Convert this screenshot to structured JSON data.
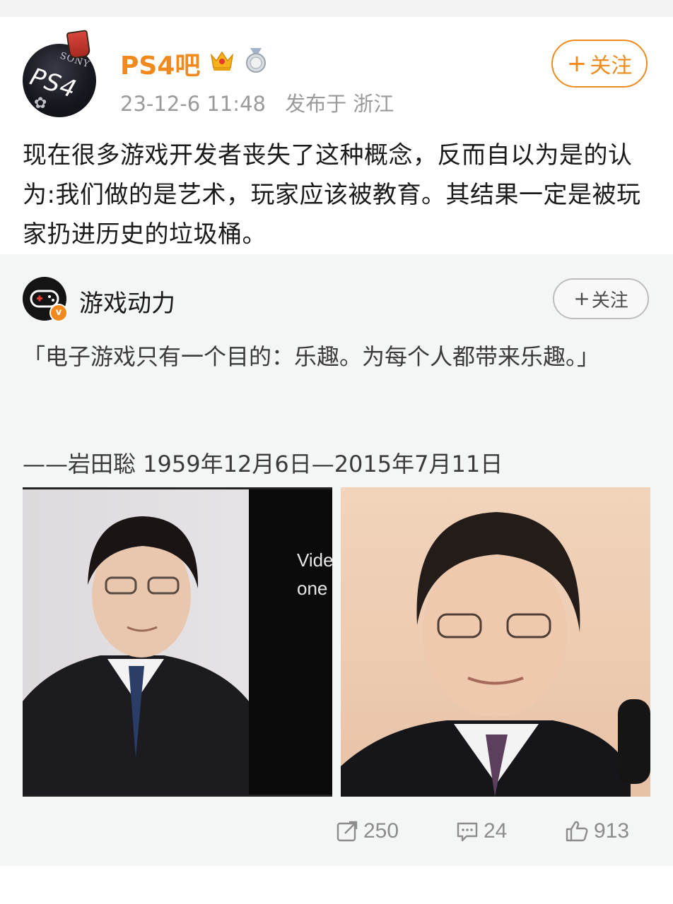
{
  "post": {
    "author": "PS4吧",
    "time": "23-12-6 11:48",
    "location": "发布于 浙江",
    "follow_label": "关注",
    "follow_plus": "+",
    "text": "现在很多游戏开发者丧失了这种概念，反而自以为是的认为:我们做的是艺术，玩家应该被教育。其结果一定是被玩家扔进历史的垃圾桶。",
    "avatar_label_sony": "SONY",
    "avatar_label_ps4": "PS4"
  },
  "repost": {
    "author": "游戏动力",
    "verified_mark": "v",
    "follow_label": "关注",
    "follow_plus": "+",
    "quote": "「电子游戏只有一个目的：乐趣。为每个人都带来乐趣。」",
    "signature": "——岩田聡 1959年12月6日—2015年7月11日",
    "images": [
      {
        "video_text_line1": "Vide",
        "video_text_line2": "one"
      },
      {}
    ]
  },
  "actions": {
    "share_count": "250",
    "comment_count": "24",
    "like_count": "913"
  },
  "colors": {
    "accent": "#f08a1e",
    "text": "#1a1a1a",
    "meta": "#9a9a9a"
  },
  "icons": [
    "crown-icon",
    "medal-icon",
    "share-icon",
    "comment-icon",
    "like-icon"
  ]
}
